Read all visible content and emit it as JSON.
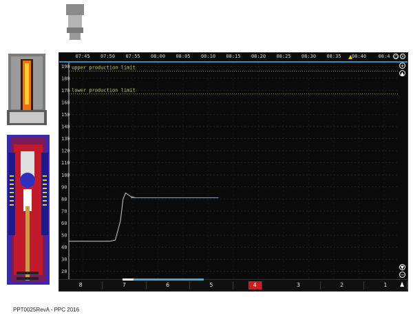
{
  "time_axis": {
    "ticks": [
      "07:45",
      "07:50",
      "07:55",
      "08:00",
      "08:05",
      "08:10",
      "08:15",
      "08:20",
      "08:25",
      "08:30",
      "08:35",
      "08:40",
      "08:4"
    ]
  },
  "limits": {
    "upper_label": "upper production limit",
    "lower_label": "lower production limit",
    "upper_value": 186,
    "lower_value": 167
  },
  "chart_data": {
    "type": "line",
    "title": "",
    "xlabel": "",
    "ylabel": "",
    "ylim": [
      13,
      193
    ],
    "y_ticks": [
      20,
      30,
      40,
      50,
      60,
      70,
      80,
      90,
      100,
      110,
      120,
      130,
      140,
      150,
      160,
      170,
      180,
      190
    ],
    "y_tick_labels": [
      "20",
      "30",
      "40",
      "50",
      "60",
      "70",
      "80",
      "90",
      "100",
      "110",
      "120",
      "130",
      "140",
      "150",
      "160",
      "170",
      "180",
      "190"
    ],
    "x_range": [
      "07:43",
      "08:47"
    ],
    "grid": true,
    "series": [
      {
        "color": "#bdbdbd",
        "points": [
          [
            "07:43",
            45
          ],
          [
            "07:51",
            45
          ],
          [
            "07:52",
            46
          ],
          [
            "07:53",
            62
          ],
          [
            "07:53.5",
            80
          ],
          [
            "07:54",
            85
          ],
          [
            "07:55",
            82
          ],
          [
            "07:56",
            81
          ]
        ]
      },
      {
        "color": "#3fa9e8",
        "points": [
          [
            "07:55",
            81
          ],
          [
            "08:12",
            81
          ]
        ]
      }
    ]
  },
  "bins": [
    "8",
    "7",
    "6",
    "5",
    "4",
    "3",
    "2",
    "1"
  ],
  "active_bin": "4",
  "controls": {
    "zoom_in_icon": "zoom-in-icon",
    "scroll_up_icon": "arrow-up-circle-icon",
    "scroll_down_icon": "arrow-down-circle-icon",
    "zoom_out_icon": "zoom-out-icon"
  },
  "colors": {
    "background": "#0b0b0b",
    "limit_line": "#c8c86a",
    "trace_current": "#3fa9e8",
    "trace_history": "#bdbdbd",
    "active_bin": "#c22222",
    "warning": "#f2c200"
  },
  "footer": "PPT0025RevA - PPC 2016"
}
